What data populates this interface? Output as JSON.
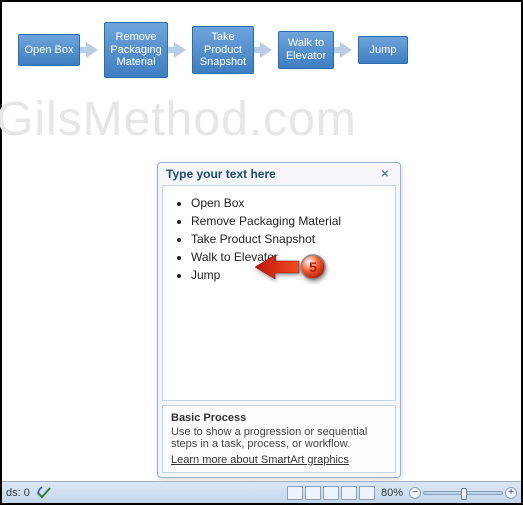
{
  "watermark": "GilsMethod.com",
  "flow": {
    "nodes": [
      "Open Box",
      "Remove Packaging Material",
      "Take Product Snapshot",
      "Walk to Elevator",
      "Jump"
    ]
  },
  "textpane": {
    "title": "Type your text here",
    "items": [
      "Open Box",
      "Remove Packaging Material",
      "Take Product Snapshot",
      "Walk to Elevator",
      "Jump"
    ],
    "footer": {
      "title": "Basic Process",
      "desc": "Use to show a progression or sequential steps in a task, process, or workflow.",
      "link": "Learn more about SmartArt graphics"
    }
  },
  "callout": {
    "number": "5"
  },
  "statusbar": {
    "words_label": "ds: 0",
    "zoom": "80%"
  }
}
